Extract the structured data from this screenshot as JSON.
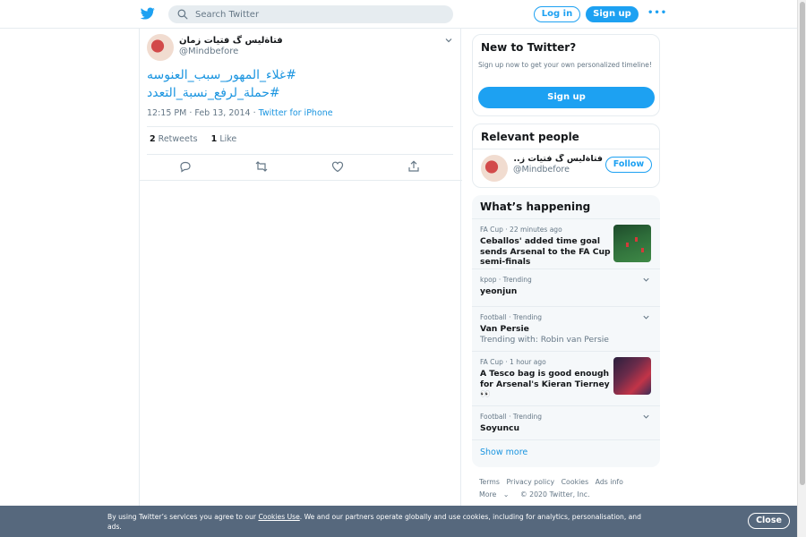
{
  "brand": {
    "accent": "#1da1f2",
    "link": "#1b95e0",
    "muted": "#657786",
    "text": "#14171a",
    "icon": "twitter-bird-icon"
  },
  "header": {
    "search_placeholder": "Search Twitter",
    "login_label": "Log in",
    "signup_label": "Sign up",
    "more_label": "•••"
  },
  "tweet": {
    "display_name": "فتاةليس گ فتيات زمان",
    "handle": "@Mindbefore",
    "text_lines": [
      "#غلاء_المهور_سبب_العنوسه",
      "#حملة_لرفع_نسبة_التعدد"
    ],
    "timestamp": "12:15 PM · Feb 13, 2014",
    "source": "Twitter for iPhone",
    "retweets_count": "2",
    "retweets_label": "Retweets",
    "likes_count": "1",
    "likes_label": "Like"
  },
  "new_to_twitter": {
    "title": "New to Twitter?",
    "description": "Sign up now to get your own personalized timeline!",
    "button": "Sign up"
  },
  "relevant_people": {
    "title": "Relevant people",
    "person": {
      "name": "فتاةليس گ فتيات ز...",
      "handle": "@Mindbefore",
      "follow_label": "Follow"
    }
  },
  "whats_happening": {
    "title": "What’s happening",
    "trends": [
      {
        "category": "FA Cup · 22 minutes ago",
        "title": "Ceballos' added time goal sends Arsenal to the FA Cup semi-finals",
        "subtitle": ""
      },
      {
        "category": "kpop · Trending",
        "title": "yeonjun",
        "subtitle": ""
      },
      {
        "category": "Football · Trending",
        "title": "Van Persie",
        "subtitle": "Trending with: Robin van Persie"
      },
      {
        "category": "FA Cup · 1 hour ago",
        "title": "A Tesco bag is good enough for Arsenal's Kieran Tierney 👀",
        "subtitle": ""
      },
      {
        "category": "Football · Trending",
        "title": "Soyuncu",
        "subtitle": ""
      }
    ],
    "show_more": "Show more"
  },
  "footer": {
    "links": [
      "Terms",
      "Privacy policy",
      "Cookies",
      "Ads info"
    ],
    "more": "More",
    "copyright": "© 2020 Twitter, Inc."
  },
  "cookie_banner": {
    "text_before": "By using Twitter’s services you agree to our ",
    "link": "Cookies Use",
    "text_after": ". We and our partners operate globally and use cookies, including for analytics, personalisation, and ads.",
    "close_label": "Close"
  }
}
